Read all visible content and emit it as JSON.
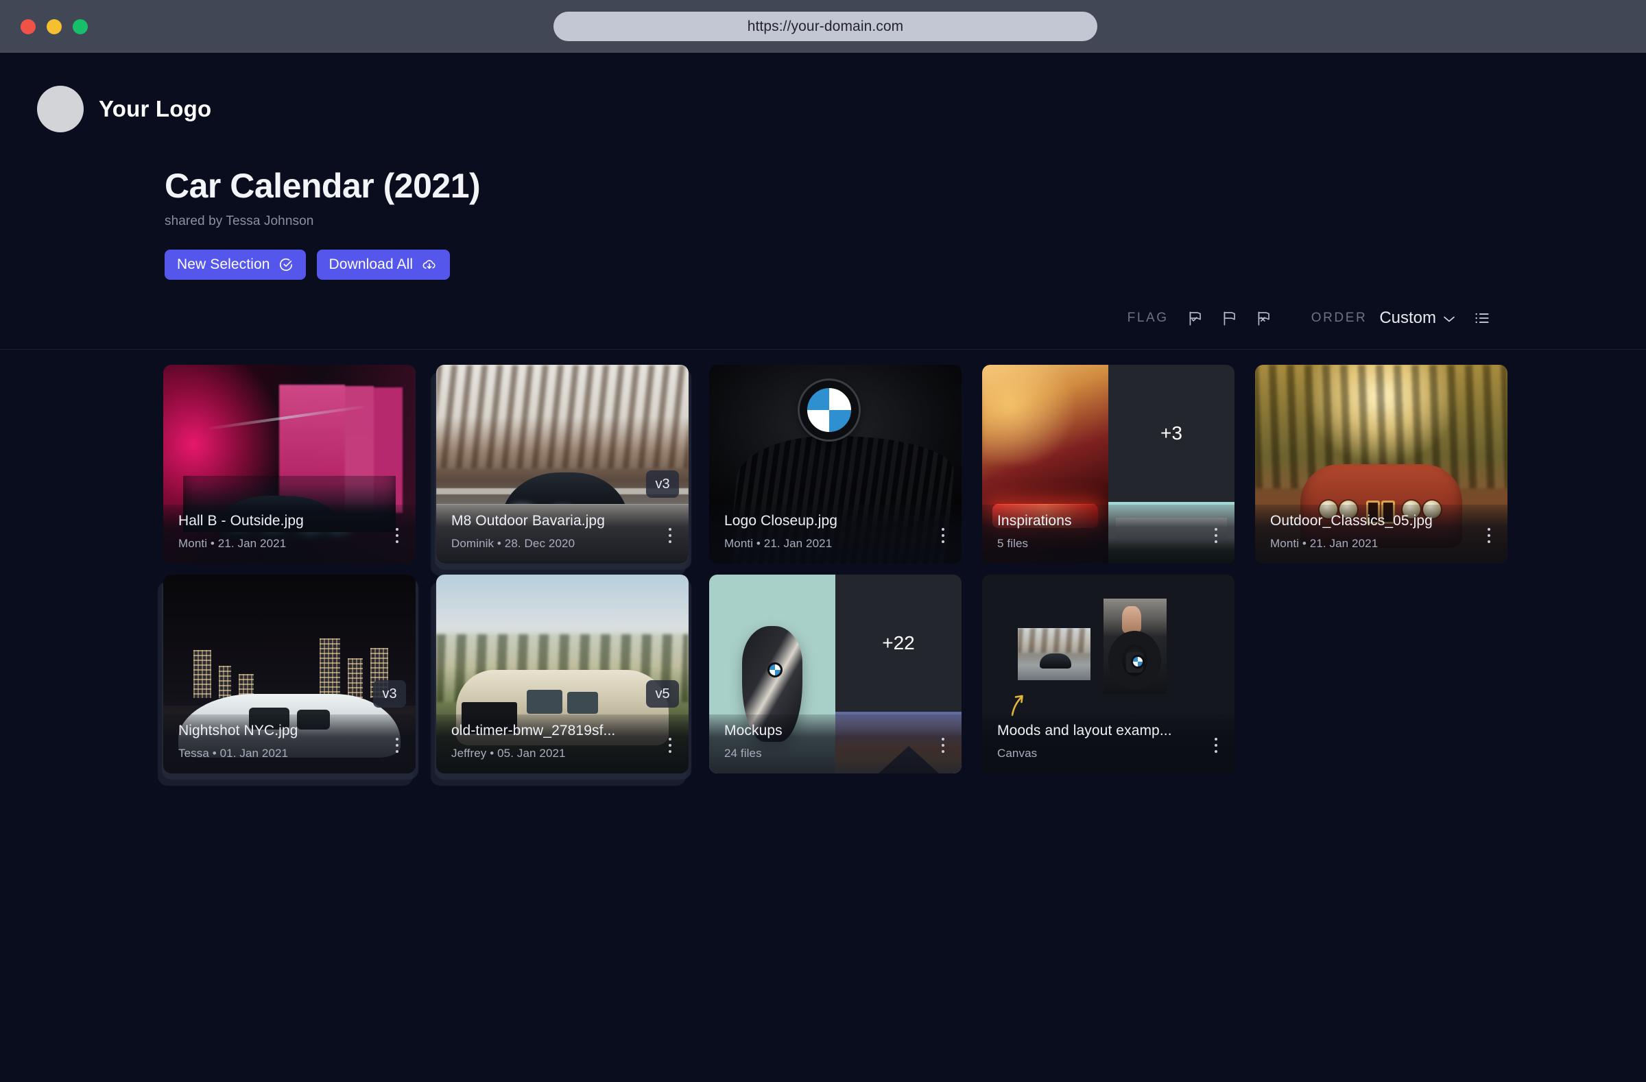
{
  "browser": {
    "url": "https://your-domain.com",
    "traffic_lights": [
      "close",
      "minimize",
      "maximize"
    ]
  },
  "brand": {
    "logo_text": "Your Logo"
  },
  "header": {
    "title": "Car Calendar (2021)",
    "subtitle": "shared by Tessa Johnson",
    "buttons": {
      "new_selection": "New Selection",
      "download_all": "Download All"
    }
  },
  "toolbar": {
    "flag_label": "FLAG",
    "flag_options": [
      "flag-check-icon",
      "flag-plain-icon",
      "flag-x-icon"
    ],
    "order_label": "ORDER",
    "order_value": "Custom",
    "view_icon": "list-view-icon"
  },
  "colors": {
    "accent": "#5456ec",
    "page_bg": "#0a0d1e",
    "chrome_bg": "#424755",
    "url_bar_bg": "#c3c7d3"
  },
  "grid": {
    "items": [
      {
        "kind": "file",
        "title": "Hall B - Outside.jpg",
        "author": "Monti",
        "date": "21. Jan 2021",
        "meta": "Monti • 21. Jan 2021",
        "version": null,
        "stacked": false,
        "scene": "hall-b-showroom"
      },
      {
        "kind": "file",
        "title": "M8 Outdoor Bavaria.jpg",
        "author": "Dominik",
        "date": "28. Dec 2020",
        "meta": "Dominik • 28. Dec 2020",
        "version": "v3",
        "stacked": true,
        "scene": "m8-outdoor-road"
      },
      {
        "kind": "file",
        "title": "Logo Closeup.jpg",
        "author": "Monti",
        "date": "21. Jan 2021",
        "meta": "Monti • 21. Jan 2021",
        "version": null,
        "stacked": false,
        "scene": "bmw-logo-grille"
      },
      {
        "kind": "folder",
        "title": "Inspirations",
        "meta": "5 files",
        "file_count": 5,
        "more_count": "+3",
        "stacked": false,
        "scene": "inspirations-mosaic"
      },
      {
        "kind": "file",
        "title": "Outdoor_Classics_05.jpg",
        "author": "Monti",
        "date": "21. Jan 2021",
        "meta": "Monti • 21. Jan 2021",
        "version": null,
        "stacked": false,
        "scene": "classic-red-bmw"
      },
      {
        "kind": "file",
        "title": "Nightshot NYC.jpg",
        "author": "Tessa",
        "date": "01. Jan 2021",
        "meta": "Tessa • 01. Jan 2021",
        "version": "v3",
        "stacked": true,
        "scene": "night-city-white-car"
      },
      {
        "kind": "file",
        "title": "old-timer-bmw_27819sf...",
        "author": "Jeffrey",
        "date": "05. Jan 2021",
        "meta": "Jeffrey • 05. Jan 2021",
        "version": "v5",
        "stacked": true,
        "scene": "old-timer-bmw"
      },
      {
        "kind": "folder",
        "title": "Mockups",
        "meta": "24 files",
        "file_count": 24,
        "more_count": "+22",
        "stacked": false,
        "scene": "mockups-mosaic"
      },
      {
        "kind": "canvas",
        "title": "Moods and layout examp...",
        "meta": "Canvas",
        "stacked": false,
        "scene": "canvas-board"
      }
    ]
  }
}
